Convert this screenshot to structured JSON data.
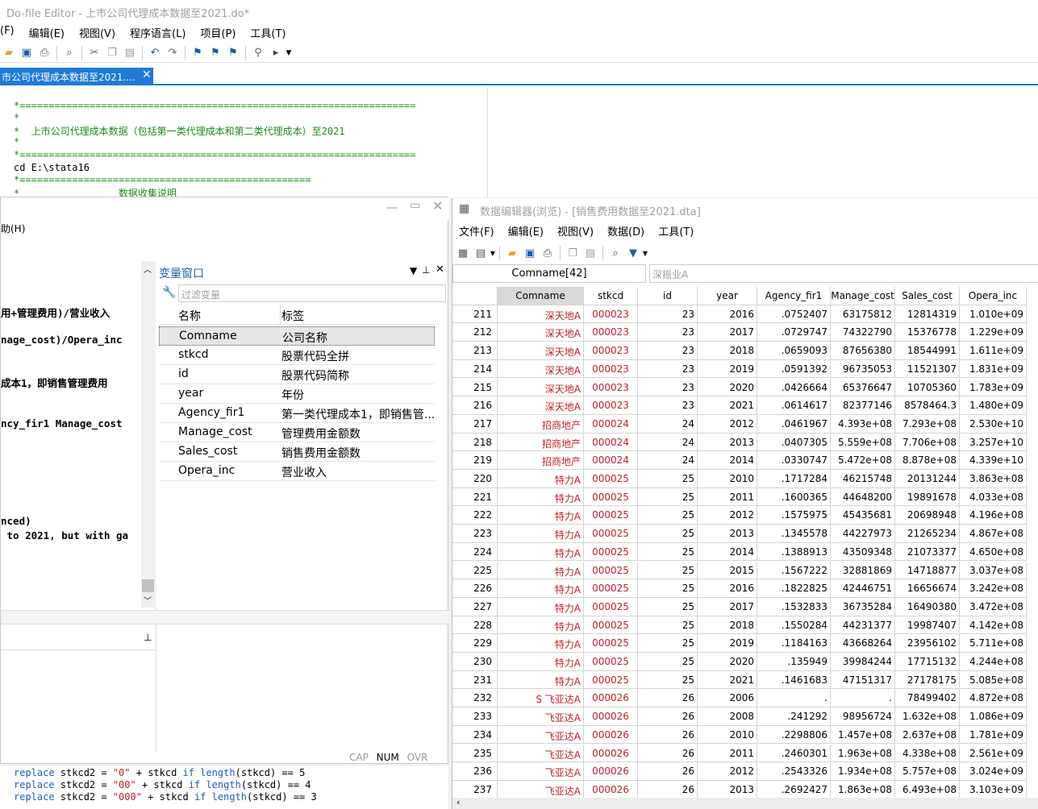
{
  "dofile": {
    "title": "Do-file Editor - 上市公司代理成本数据至2021.do*",
    "menu": [
      "(F)",
      "编辑(E)",
      "视图(V)",
      "程序语言(L)",
      "项目(P)",
      "工具(T)"
    ],
    "tab_label": "市公司代理成本数据至2021....",
    "tab_close": "✕",
    "code_lines": [
      "*====================================================================",
      "*",
      "*  上市公司代理成本数据（包括第一类代理成本和第二类代理成本）至2021",
      "*",
      "*====================================================================",
      "cd E:\\stata16",
      "*==================================================",
      "*                 数据收集说明"
    ]
  },
  "left_panel": {
    "help_menu": "助(H)",
    "command_lines": [
      "用+管理费用)/营业收入",
      "nage_cost)/Opera_inc",
      "成本1，即销售管理费用",
      "ncy_fir1 Manage_cost",
      "nced)",
      " to 2021, but with ga"
    ],
    "variables_window": {
      "title": "变量窗口",
      "filter_placeholder": "过滤变量",
      "col_name": "名称",
      "col_label": "标签",
      "rows": [
        {
          "name": "Comname",
          "label": "公司名称"
        },
        {
          "name": "stkcd",
          "label": "股票代码全拼"
        },
        {
          "name": "id",
          "label": "股票代码简称"
        },
        {
          "name": "year",
          "label": "年份"
        },
        {
          "name": "Agency_fir1",
          "label": "第一类代理成本1，即销售管..."
        },
        {
          "name": "Manage_cost",
          "label": "管理费用金额数"
        },
        {
          "name": "Sales_cost",
          "label": "销售费用金额数"
        },
        {
          "name": "Opera_inc",
          "label": "营业收入"
        }
      ]
    },
    "status": {
      "cap": "CAP",
      "num": "NUM",
      "ovr": "OVR"
    }
  },
  "bottom_code": [
    {
      "a": "replace",
      "b": " stkcd2 = ",
      "c": "\"0\"",
      "d": " + stkcd ",
      "e": "if",
      "f": " ",
      "g": "length",
      "h": "(stkcd) == 5"
    },
    {
      "a": "replace",
      "b": " stkcd2 = ",
      "c": "\"00\"",
      "d": " + stkcd ",
      "e": "if",
      "f": " ",
      "g": "length",
      "h": "(stkcd) == 4"
    },
    {
      "a": "replace",
      "b": " stkcd2 = ",
      "c": "\"000\"",
      "d": " + stkcd ",
      "e": "if",
      "f": " ",
      "g": "length",
      "h": "(stkcd) == 3"
    }
  ],
  "data_editor": {
    "title": "数据编辑器(浏览) - [销售费用数据至2021.dta]",
    "menu": [
      "文件(F)",
      "编辑(E)",
      "视图(V)",
      "数据(D)",
      "工具(T)"
    ],
    "varname_box": "Comname[42]",
    "cell_value": "深振业A",
    "columns": [
      "Comname",
      "stkcd",
      "id",
      "year",
      "Agency_fir1",
      "Manage_cost",
      "Sales_cost",
      "Opera_inc"
    ],
    "rows": [
      [
        "211",
        "深天地A",
        "000023",
        "23",
        "2016",
        ".0752407",
        "63175812",
        "12814319",
        "1.010e+09"
      ],
      [
        "212",
        "深天地A",
        "000023",
        "23",
        "2017",
        ".0729747",
        "74322790",
        "15376778",
        "1.229e+09"
      ],
      [
        "213",
        "深天地A",
        "000023",
        "23",
        "2018",
        ".0659093",
        "87656380",
        "18544991",
        "1.611e+09"
      ],
      [
        "214",
        "深天地A",
        "000023",
        "23",
        "2019",
        ".0591392",
        "96735053",
        "11521307",
        "1.831e+09"
      ],
      [
        "215",
        "深天地A",
        "000023",
        "23",
        "2020",
        ".0426664",
        "65376647",
        "10705360",
        "1.783e+09"
      ],
      [
        "216",
        "深天地A",
        "000023",
        "23",
        "2021",
        ".0614617",
        "82377146",
        "8578464.3",
        "1.480e+09"
      ],
      [
        "217",
        "招商地产",
        "000024",
        "24",
        "2012",
        ".0461967",
        "4.393e+08",
        "7.293e+08",
        "2.530e+10"
      ],
      [
        "218",
        "招商地产",
        "000024",
        "24",
        "2013",
        ".0407305",
        "5.559e+08",
        "7.706e+08",
        "3.257e+10"
      ],
      [
        "219",
        "招商地产",
        "000024",
        "24",
        "2014",
        ".0330747",
        "5.472e+08",
        "8.878e+08",
        "4.339e+10"
      ],
      [
        "220",
        "特力A",
        "000025",
        "25",
        "2010",
        ".1717284",
        "46215748",
        "20131244",
        "3.863e+08"
      ],
      [
        "221",
        "特力A",
        "000025",
        "25",
        "2011",
        ".1600365",
        "44648200",
        "19891678",
        "4.033e+08"
      ],
      [
        "222",
        "特力A",
        "000025",
        "25",
        "2012",
        ".1575975",
        "45435681",
        "20698948",
        "4.196e+08"
      ],
      [
        "223",
        "特力A",
        "000025",
        "25",
        "2013",
        ".1345578",
        "44227973",
        "21265234",
        "4.867e+08"
      ],
      [
        "224",
        "特力A",
        "000025",
        "25",
        "2014",
        ".1388913",
        "43509348",
        "21073377",
        "4.650e+08"
      ],
      [
        "225",
        "特力A",
        "000025",
        "25",
        "2015",
        ".1567222",
        "32881869",
        "14718877",
        "3.037e+08"
      ],
      [
        "226",
        "特力A",
        "000025",
        "25",
        "2016",
        ".1822825",
        "42446751",
        "16656674",
        "3.242e+08"
      ],
      [
        "227",
        "特力A",
        "000025",
        "25",
        "2017",
        ".1532833",
        "36735284",
        "16490380",
        "3.472e+08"
      ],
      [
        "228",
        "特力A",
        "000025",
        "25",
        "2018",
        ".1550284",
        "44231377",
        "19987407",
        "4.142e+08"
      ],
      [
        "229",
        "特力A",
        "000025",
        "25",
        "2019",
        ".1184163",
        "43668264",
        "23956102",
        "5.711e+08"
      ],
      [
        "230",
        "特力A",
        "000025",
        "25",
        "2020",
        ".135949",
        "39984244",
        "17715132",
        "4.244e+08"
      ],
      [
        "231",
        "特力A",
        "000025",
        "25",
        "2021",
        ".1461683",
        "47151317",
        "27178175",
        "5.085e+08"
      ],
      [
        "232",
        "S 飞亚达A",
        "000026",
        "26",
        "2006",
        ".",
        ".",
        "78499402",
        "4.872e+08"
      ],
      [
        "233",
        "飞亚达A",
        "000026",
        "26",
        "2008",
        ".241292",
        "98956724",
        "1.632e+08",
        "1.086e+09"
      ],
      [
        "234",
        "飞亚达A",
        "000026",
        "26",
        "2010",
        ".2298806",
        "1.457e+08",
        "2.637e+08",
        "1.781e+09"
      ],
      [
        "235",
        "飞亚达A",
        "000026",
        "26",
        "2011",
        ".2460301",
        "1.963e+08",
        "4.338e+08",
        "2.561e+09"
      ],
      [
        "236",
        "飞亚达A",
        "000026",
        "26",
        "2012",
        ".2543326",
        "1.934e+08",
        "5.757e+08",
        "3.024e+09"
      ],
      [
        "237",
        "飞亚达A",
        "000026",
        "26",
        "2013",
        ".2692427",
        "1.863e+08",
        "6.493e+08",
        "3.103e+09"
      ]
    ]
  }
}
